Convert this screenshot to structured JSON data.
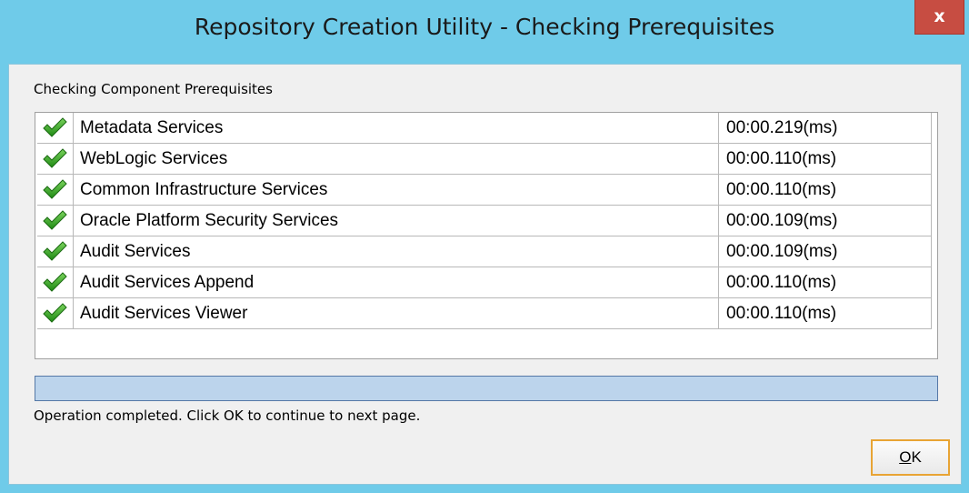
{
  "window": {
    "title": "Repository Creation Utility - Checking Prerequisites",
    "close_glyph": "x"
  },
  "section_label": "Checking Component Prerequisites",
  "components": [
    {
      "name": "Metadata Services",
      "time": "00:00.219(ms)",
      "status_icon": "check-icon",
      "status": "passed"
    },
    {
      "name": "WebLogic Services",
      "time": "00:00.110(ms)",
      "status_icon": "check-icon",
      "status": "passed"
    },
    {
      "name": "Common Infrastructure Services",
      "time": "00:00.110(ms)",
      "status_icon": "check-icon",
      "status": "passed"
    },
    {
      "name": "Oracle Platform Security Services",
      "time": "00:00.109(ms)",
      "status_icon": "check-icon",
      "status": "passed"
    },
    {
      "name": "Audit Services",
      "time": "00:00.109(ms)",
      "status_icon": "check-icon",
      "status": "passed"
    },
    {
      "name": "Audit Services Append",
      "time": "00:00.110(ms)",
      "status_icon": "check-icon",
      "status": "passed"
    },
    {
      "name": "Audit Services Viewer",
      "time": "00:00.110(ms)",
      "status_icon": "check-icon",
      "status": "passed"
    }
  ],
  "progress": {
    "fraction": 1.0
  },
  "status_message": "Operation completed. Click OK to continue to next page.",
  "buttons": {
    "ok_label": "OK"
  },
  "colors": {
    "window_frame": "#6fcbe9",
    "close_button": "#c74d42",
    "check_green": "#2e9a1e",
    "progress_fill": "#bcd4ec",
    "ok_focus_border": "#e8a434"
  }
}
